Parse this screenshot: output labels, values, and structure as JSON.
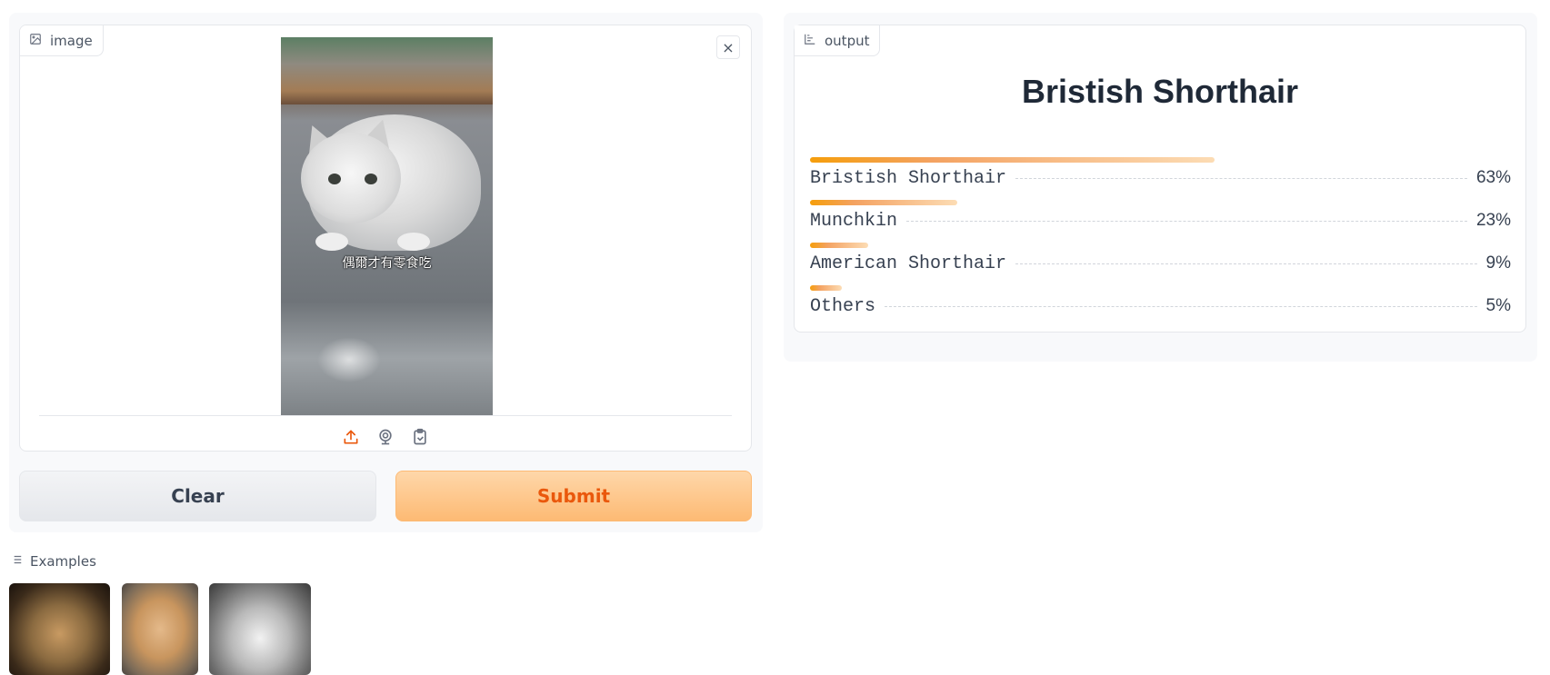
{
  "input": {
    "label": "image",
    "photo_caption": "偶爾才有零食吃",
    "close_symbol": "×",
    "sources": [
      "upload-icon",
      "webcam-icon",
      "clipboard-icon"
    ]
  },
  "buttons": {
    "clear": "Clear",
    "submit": "Submit"
  },
  "examples": {
    "label": "Examples",
    "count": 3
  },
  "output": {
    "label": "output",
    "top_label": "Bristish Shorthair",
    "confidences": [
      {
        "label": "Bristish Shorthair",
        "pct": "63%",
        "value": 0.63
      },
      {
        "label": "Munchkin",
        "pct": "23%",
        "value": 0.23
      },
      {
        "label": "American Shorthair",
        "pct": "9%",
        "value": 0.09
      },
      {
        "label": "Others",
        "pct": "5%",
        "value": 0.05
      }
    ]
  },
  "colors": {
    "accent": "#ea580c",
    "bar_start": "#f59e0b",
    "bar_end": "#fcdcb4"
  }
}
